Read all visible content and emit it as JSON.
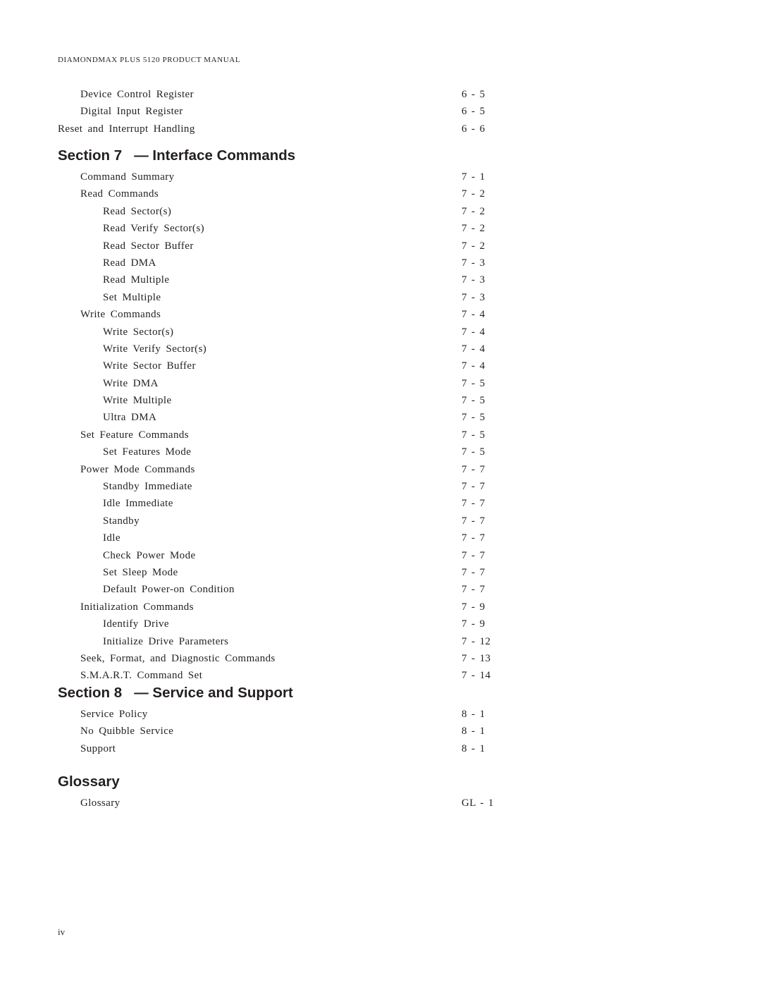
{
  "running_head": "DIAMONDMAX PLUS 5120 PRODUCT MANUAL",
  "top_entries": [
    {
      "title": "Device Control Register",
      "page": "6 - 5",
      "level": 1
    },
    {
      "title": "Digital Input Register",
      "page": "6 - 5",
      "level": 1
    },
    {
      "title": "Reset and Interrupt Handling",
      "page": "6 - 6",
      "level": 0
    }
  ],
  "sections": [
    {
      "heading": "Section 7   — Interface Commands",
      "entries": [
        {
          "title": "Command Summary",
          "page": "7 - 1",
          "level": 1
        },
        {
          "title": "Read Commands",
          "page": "7 - 2",
          "level": 1
        },
        {
          "title": "Read Sector(s)",
          "page": "7 - 2",
          "level": 2
        },
        {
          "title": "Read Verify Sector(s)",
          "page": "7 - 2",
          "level": 2
        },
        {
          "title": "Read Sector Buffer",
          "page": "7 - 2",
          "level": 2
        },
        {
          "title": "Read DMA",
          "page": "7 - 3",
          "level": 2
        },
        {
          "title": "Read Multiple",
          "page": "7 - 3",
          "level": 2
        },
        {
          "title": "Set Multiple",
          "page": "7 - 3",
          "level": 2
        },
        {
          "title": "Write Commands",
          "page": "7 - 4",
          "level": 1
        },
        {
          "title": "Write Sector(s)",
          "page": "7 - 4",
          "level": 2
        },
        {
          "title": "Write Verify Sector(s)",
          "page": "7 - 4",
          "level": 2
        },
        {
          "title": "Write Sector Buffer",
          "page": "7 - 4",
          "level": 2
        },
        {
          "title": "Write DMA",
          "page": "7 - 5",
          "level": 2
        },
        {
          "title": "Write Multiple",
          "page": "7 - 5",
          "level": 2
        },
        {
          "title": "Ultra DMA",
          "page": "7 - 5",
          "level": 2
        },
        {
          "title": "Set Feature Commands",
          "page": "7 - 5",
          "level": 1
        },
        {
          "title": "Set Features Mode",
          "page": "7 - 5",
          "level": 2
        },
        {
          "title": "Power Mode Commands",
          "page": "7 - 7",
          "level": 1
        },
        {
          "title": "Standby Immediate",
          "page": "7 - 7",
          "level": 2
        },
        {
          "title": "Idle Immediate",
          "page": "7 - 7",
          "level": 2
        },
        {
          "title": "Standby",
          "page": "7 - 7",
          "level": 2
        },
        {
          "title": "Idle",
          "page": "7 - 7",
          "level": 2
        },
        {
          "title": "Check Power Mode",
          "page": "7 - 7",
          "level": 2
        },
        {
          "title": "Set Sleep Mode",
          "page": "7 - 7",
          "level": 2
        },
        {
          "title": "Default Power-on Condition",
          "page": "7 - 7",
          "level": 2
        },
        {
          "title": "Initialization Commands",
          "page": "7 - 9",
          "level": 1
        },
        {
          "title": "Identify Drive",
          "page": "7 - 9",
          "level": 2
        },
        {
          "title": "Initialize Drive Parameters",
          "page": "7 - 12",
          "level": 2
        },
        {
          "title": "Seek, Format, and Diagnostic Commands",
          "page": "7 - 13",
          "level": 1
        },
        {
          "title": "S.M.A.R.T. Command Set",
          "page": "7 - 14",
          "level": 1
        }
      ]
    },
    {
      "heading": "Section 8   — Service and Support",
      "entries": [
        {
          "title": "Service Policy",
          "page": "8 - 1",
          "level": 1
        },
        {
          "title": "No Quibble Service",
          "page": "8 - 1",
          "level": 1
        },
        {
          "title": "Support",
          "page": "8 - 1",
          "level": 1
        }
      ]
    },
    {
      "heading": "Glossary",
      "entries": [
        {
          "title": "Glossary",
          "page": "GL - 1",
          "level": 1
        }
      ]
    }
  ],
  "folio": "iv"
}
